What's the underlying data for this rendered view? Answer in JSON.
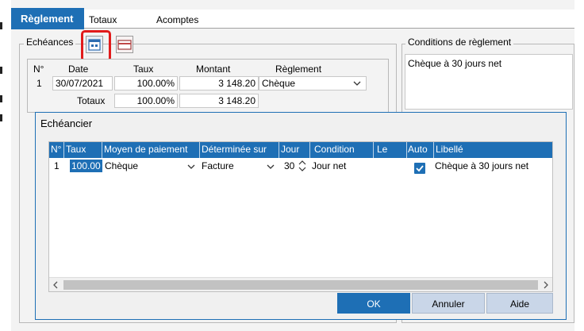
{
  "tabs": [
    "Règlement",
    "Totaux",
    "Acomptes"
  ],
  "echeances": {
    "legend": "Echéances",
    "headers": [
      "N°",
      "Date",
      "Taux",
      "Montant",
      "Règlement"
    ],
    "row": {
      "num": "1",
      "date": "30/07/2021",
      "taux": "100.00%",
      "montant": "3 148.20",
      "reglement": "Chèque"
    },
    "totals_label": "Totaux",
    "totals_taux": "100.00%",
    "totals_montant": "3 148.20"
  },
  "conditions": {
    "legend": "Conditions de règlement",
    "text": "Chèque à 30 jours net"
  },
  "dialog": {
    "title": "Echéancier",
    "columns": [
      "N°",
      "Taux",
      "Moyen de paiement",
      "Déterminée sur",
      "Jour",
      "Condition",
      "Le",
      "Auto",
      "Libellé"
    ],
    "row": {
      "num": "1",
      "taux": "100.00",
      "moyen": "Chèque",
      "determinee": "Facture",
      "jour": "30",
      "condition": "Jour net",
      "le": "",
      "libelle": "Chèque à 30 jours net"
    },
    "buttons": {
      "ok": "OK",
      "cancel": "Annuler",
      "help": "Aide"
    }
  },
  "colors": {
    "accent": "#1e6fb5",
    "highlight": "#e11b1b"
  },
  "icons": [
    "calendar-icon",
    "card-icon",
    "chevron-down-icon",
    "spinner-icon",
    "check-icon",
    "scroll-left-icon",
    "scroll-right-icon"
  ]
}
